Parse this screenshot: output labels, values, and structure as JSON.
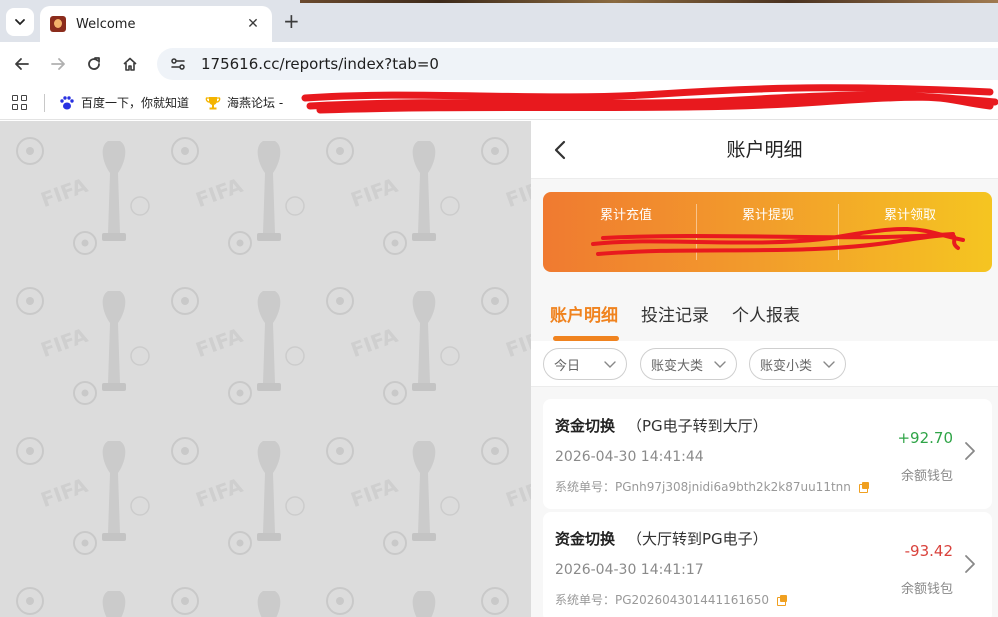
{
  "browser": {
    "tab_title": "Welcome",
    "new_tab_symbol": "+",
    "url": "175616.cc/reports/index?tab=0",
    "bookmarks": [
      {
        "label": "百度一下，你就知道",
        "icon": "baidu-paw-icon"
      },
      {
        "label": "海燕论坛 -",
        "icon": "trophy-icon"
      }
    ]
  },
  "app": {
    "page_title": "账户明细",
    "summary": {
      "stats": [
        {
          "label": "累计充值"
        },
        {
          "label": "累计提现"
        },
        {
          "label": "累计领取"
        }
      ],
      "gradient": [
        "#f07a30",
        "#f5c521"
      ]
    },
    "tabs": [
      {
        "label": "账户明细",
        "active": true
      },
      {
        "label": "投注记录",
        "active": false
      },
      {
        "label": "个人报表",
        "active": false
      }
    ],
    "filters": [
      {
        "label": "今日"
      },
      {
        "label": "账变大类"
      },
      {
        "label": "账变小类"
      }
    ],
    "records": [
      {
        "type": "资金切换",
        "detail": "（PG电子转到大厅）",
        "time": "2026-04-30 14:41:44",
        "order": "系统单号：PGnh97j308jnidi6a9bth2k2k87uu11tnn",
        "amount": "+92.70",
        "wallet": "余额钱包"
      },
      {
        "type": "资金切换",
        "detail": "（大厅转到PG电子）",
        "time": "2026-04-30 14:41:17",
        "order": "系统单号：PG202604301441161650",
        "amount": "-93.42",
        "wallet": "余额钱包"
      }
    ]
  },
  "colors": {
    "accent": "#f0831f",
    "positive": "#2fa447",
    "negative": "#d9423c"
  }
}
